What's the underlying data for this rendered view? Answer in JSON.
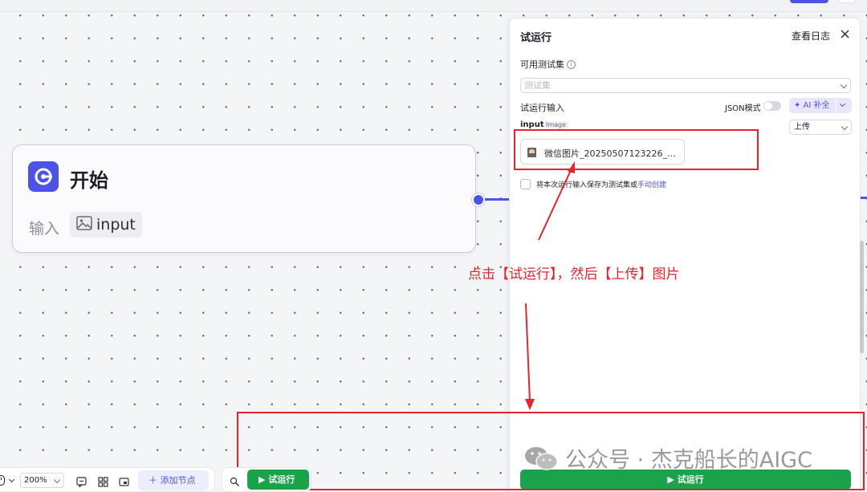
{
  "start_node": {
    "title": "开始",
    "input_label": "输入",
    "input_chip": "input"
  },
  "panel": {
    "title": "试运行",
    "view_log": "查看日志",
    "close_icon": "×",
    "test_set_label": "可用测试集",
    "test_set_placeholder": "测试集",
    "run_input_label": "试运行输入",
    "json_mode_label": "JSON模式",
    "ai_button": "✦ AI 补全",
    "input_name": "input",
    "input_type_tag": "Image",
    "upload_select": "上传",
    "file_name": "微信图片_20250507123226_…",
    "save_text_prefix": "将本次运行输入保存为测试集或",
    "save_text_link": "手动创建",
    "run_button": "▶  试运行"
  },
  "annotation": {
    "instruction": "点击【试运行】，然后【上传】图片",
    "color": "#e8232b"
  },
  "watermark": {
    "text": "公众号 · 杰克船长的AIGC"
  },
  "toolbar": {
    "zoom": "200%",
    "add_node": "＋  添加节点",
    "run_button": "▶  试运行"
  },
  "colors": {
    "accent": "#4d53e8",
    "run_green": "#1aa34a"
  }
}
